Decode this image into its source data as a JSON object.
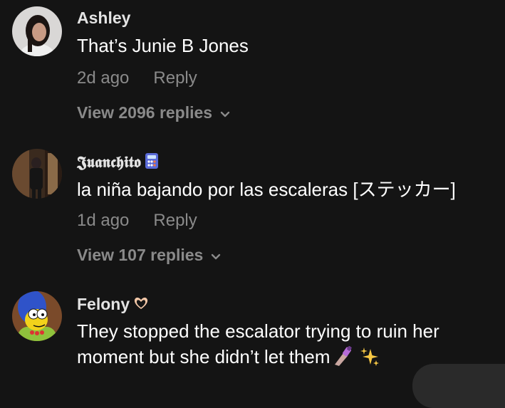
{
  "comments": [
    {
      "username": "Ashley",
      "text": "That’s Junie B Jones",
      "time": "2d ago",
      "reply_label": "Reply",
      "view_replies": "View 2096 replies"
    },
    {
      "username": "𝕵𝖚𝖆𝖓𝖈𝖍𝖎𝖙𝖔",
      "username_emoji": "calculator-icon",
      "text": "la niña bajando por las escaleras [ステッカー]",
      "time": "1d ago",
      "reply_label": "Reply",
      "view_replies": "View 107 replies"
    },
    {
      "username": "Felony",
      "username_emoji": "heart-hands-icon",
      "text_line1": "They stopped the escalator trying to ruin her",
      "text_line2": "moment but she didn’t let them",
      "text_emojis": [
        "nail-polish-icon",
        "sparkles-icon"
      ]
    }
  ],
  "colors": {
    "background": "#141414",
    "primary_text": "#ffffff",
    "username": "#e3e3e3",
    "secondary_text": "#8a8a8a"
  }
}
